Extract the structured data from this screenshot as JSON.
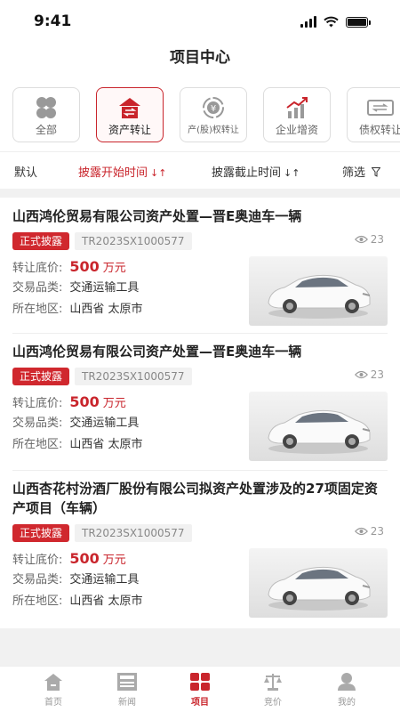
{
  "status_bar": {
    "time": "9:41"
  },
  "header": {
    "title": "项目中心"
  },
  "categories": [
    {
      "label": "全部",
      "icon": "four-leaf-icon"
    },
    {
      "label": "资产转让",
      "icon": "asset-transfer-icon",
      "active": true
    },
    {
      "label": "产(股)权转让",
      "icon": "equity-transfer-icon"
    },
    {
      "label": "企业增资",
      "icon": "capital-increase-icon"
    },
    {
      "label": "债权转让",
      "icon": "debt-transfer-icon"
    }
  ],
  "filters": {
    "default": "默认",
    "start_time": "披露开始时间",
    "end_time": "披露截止时间",
    "filter": "筛选"
  },
  "labels": {
    "price": "转让底价:",
    "category": "交易品类:",
    "region": "所在地区:"
  },
  "projects": [
    {
      "title": "山西鸿伦贸易有限公司资产处置—晋E奥迪车一辆",
      "status": "正式披露",
      "code": "TR2023SX1000577",
      "views": "23",
      "price": "500",
      "unit": "万元",
      "category": "交通运输工具",
      "region": "山西省 太原市"
    },
    {
      "title": "山西鸿伦贸易有限公司资产处置—晋E奥迪车一辆",
      "status": "正式披露",
      "code": "TR2023SX1000577",
      "views": "23",
      "price": "500",
      "unit": "万元",
      "category": "交通运输工具",
      "region": "山西省 太原市"
    },
    {
      "title": "山西杏花村汾酒厂股份有限公司拟资产处置涉及的27项固定资产项目（车辆）",
      "status": "正式披露",
      "code": "TR2023SX1000577",
      "views": "23",
      "price": "500",
      "unit": "万元",
      "category": "交通运输工具",
      "region": "山西省 太原市"
    }
  ],
  "tabs": [
    {
      "label": "首页",
      "icon": "home-icon"
    },
    {
      "label": "新闻",
      "icon": "news-icon"
    },
    {
      "label": "项目",
      "icon": "project-icon",
      "active": true
    },
    {
      "label": "竞价",
      "icon": "auction-icon"
    },
    {
      "label": "我的",
      "icon": "user-icon"
    }
  ],
  "colors": {
    "accent": "#c9252c",
    "background": "#f1f1f1"
  }
}
